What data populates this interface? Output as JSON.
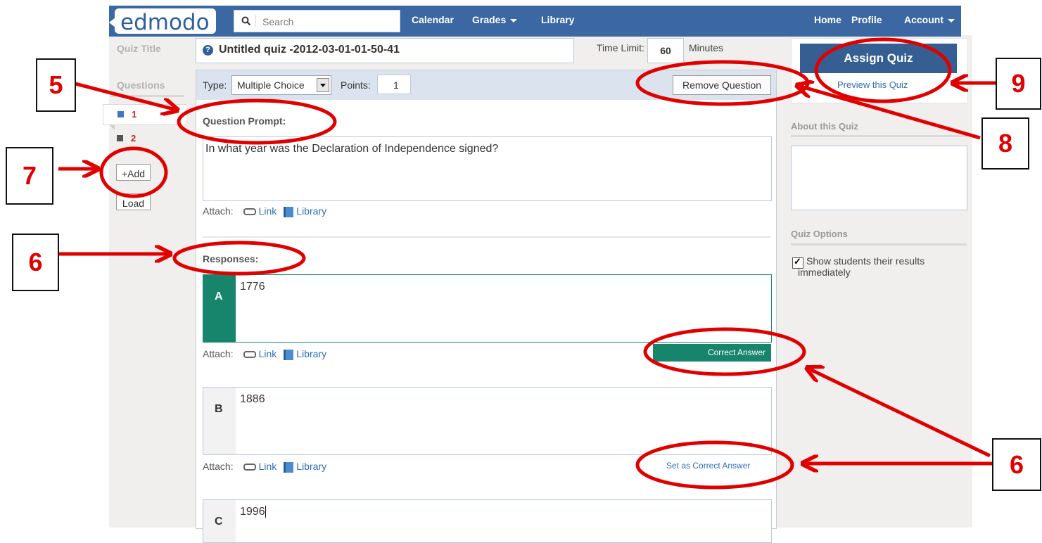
{
  "app": {
    "logo": "edmodo"
  },
  "nav": {
    "search_placeholder": "Search",
    "calendar": "Calendar",
    "grades": "Grades",
    "library": "Library",
    "home": "Home",
    "profile": "Profile",
    "account": "Account"
  },
  "left": {
    "quiz_title_label": "Quiz Title",
    "questions_label": "Questions",
    "questions": [
      {
        "num": "1"
      },
      {
        "num": "2"
      }
    ],
    "add_label": "+Add",
    "load_label": "Load"
  },
  "quiz": {
    "title": "Untitled quiz -2012-03-01-01-50-41",
    "time_limit_label": "Time Limit:",
    "time_limit_value": "60",
    "minutes_label": "Minutes"
  },
  "question": {
    "type_label": "Type:",
    "type_value": "Multiple Choice",
    "points_label": "Points:",
    "points_value": "1",
    "remove_label": "Remove Question",
    "prompt_label": "Question Prompt:",
    "prompt_text": "In what year was the Declaration of Independence signed?",
    "attach_label": "Attach:",
    "link_label": "Link",
    "library_label": "Library",
    "responses_label": "Responses:",
    "responses": [
      {
        "letter": "A",
        "value": "1776"
      },
      {
        "letter": "B",
        "value": "1886"
      },
      {
        "letter": "C",
        "value": "1996"
      }
    ],
    "correct_answer_label": "Correct Answer",
    "set_correct_label": "Set as Correct Answer"
  },
  "right": {
    "assign_label": "Assign Quiz",
    "preview_label": "Preview this Quiz",
    "about_label": "About this Quiz",
    "options_label": "Quiz Options",
    "option_show_results": "Show students their results immediately"
  },
  "annotations": [
    "5",
    "7",
    "6",
    "9",
    "8",
    "6"
  ],
  "colors": {
    "nav": "#3b67a3",
    "correct": "#17846c",
    "assign": "#355f92",
    "annotation": "#e00000"
  }
}
